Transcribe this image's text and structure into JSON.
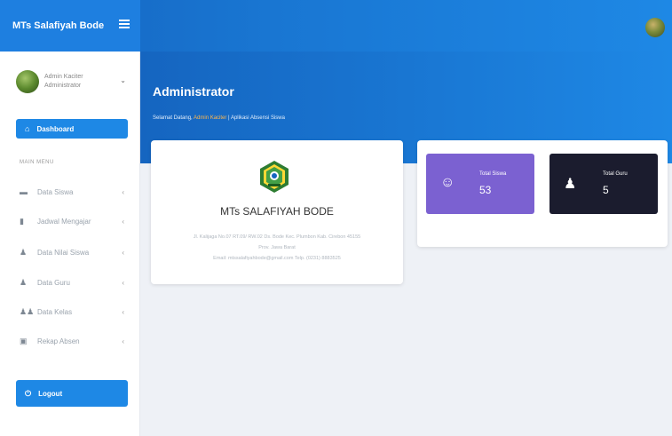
{
  "topbar": {
    "brand": "MTs Salafiyah Bode",
    "menu_icon": "hamburger-icon",
    "avatar_icon": "user-avatar-icon"
  },
  "sidebar": {
    "user": {
      "name": "Admin Kaciter",
      "role": "Administrator"
    },
    "active_item": {
      "icon": "home-icon",
      "label": "Dashboard"
    },
    "section_label": "MAIN MENU",
    "items": [
      {
        "icon": "folder-icon",
        "label": "Data Siswa",
        "chevron": "‹"
      },
      {
        "icon": "trash-icon",
        "label": "Jadwal Mengajar",
        "chevron": "‹"
      },
      {
        "icon": "user-icon",
        "label": "Data Nilai Siswa",
        "chevron": "‹"
      },
      {
        "icon": "user-icon",
        "label": "Data Guru",
        "chevron": "‹"
      },
      {
        "icon": "users-icon",
        "label": "Data Kelas",
        "chevron": "‹"
      },
      {
        "icon": "book-icon",
        "label": "Rekap Absen",
        "chevron": "‹"
      }
    ],
    "logout": {
      "icon": "power-icon",
      "label": "Logout"
    }
  },
  "header": {
    "title": "Administrator",
    "welcome_prefix": "Selamat Datang, ",
    "welcome_name": "Admin Kaciter",
    "welcome_suffix": " | Aplikasi Absensi Siswa"
  },
  "school": {
    "name": "MTs SALAFIYAH BODE",
    "address": "Jl. Kalijaga No.07 RT.09/ RW.02 Ds. Bode Kec. Plumbon Kab. Cirebon 45155",
    "province": "Prov. Jawa Barat",
    "contact": "Email: mtssalafiyahbode@gmail.com Telp. (0231) 8883525"
  },
  "stats": [
    {
      "icon": "user-icon",
      "label": "Total Siswa",
      "value": "53",
      "color": "#7b61d1"
    },
    {
      "icon": "user-tie-icon",
      "label": "Total Guru",
      "value": "5",
      "color": "#1b1c2e"
    }
  ]
}
